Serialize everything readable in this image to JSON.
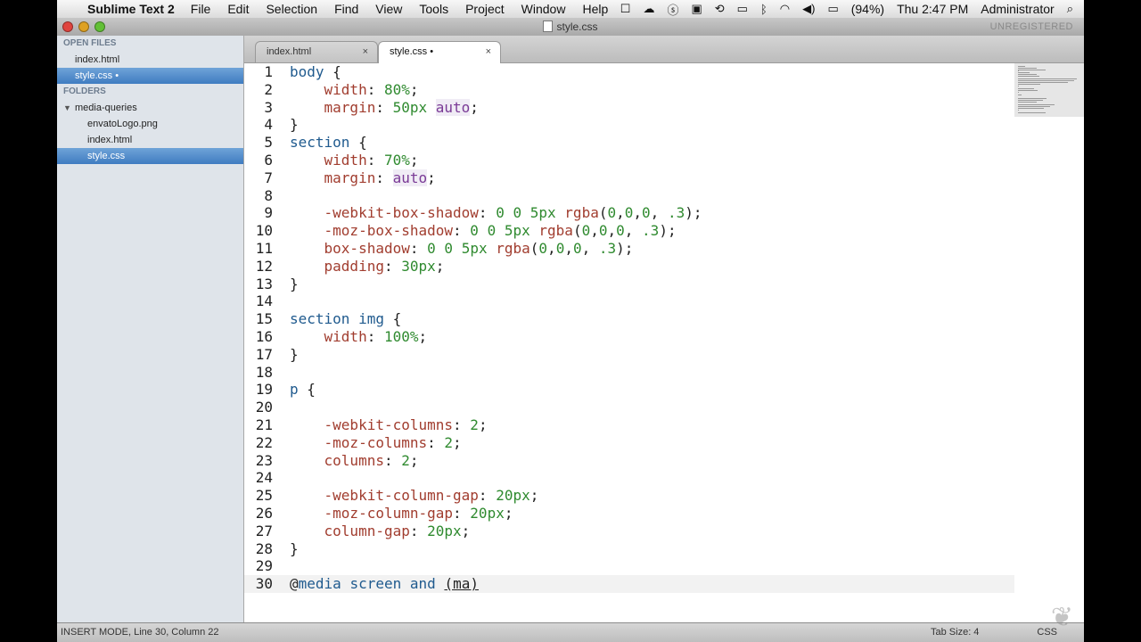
{
  "menubar": {
    "app_name": "Sublime Text 2",
    "menus": [
      "File",
      "Edit",
      "Selection",
      "Find",
      "View",
      "Tools",
      "Project",
      "Window",
      "Help"
    ],
    "battery": "(94%)",
    "clock": "Thu 2:47 PM",
    "user": "Administrator"
  },
  "window": {
    "title": "style.css",
    "unregistered": "UNREGISTERED"
  },
  "sidebar": {
    "open_files_header": "OPEN FILES",
    "open_files": [
      "index.html",
      "style.css"
    ],
    "modified_marker": "•",
    "folders_header": "FOLDERS",
    "folder": "media-queries",
    "folder_files": [
      "envatoLogo.png",
      "index.html",
      "style.css"
    ]
  },
  "tabs": [
    {
      "label": "index.html",
      "close": "×"
    },
    {
      "label": "style.css •",
      "close": "×"
    }
  ],
  "editor": {
    "lines": [
      "body {",
      "    width: 80%;",
      "    margin: 50px auto;",
      "}",
      "section {",
      "    width: 70%;",
      "    margin: auto;",
      "",
      "    -webkit-box-shadow: 0 0 5px rgba(0,0,0, .3);",
      "    -moz-box-shadow: 0 0 5px rgba(0,0,0, .3);",
      "    box-shadow: 0 0 5px rgba(0,0,0, .3);",
      "    padding: 30px;",
      "}",
      "",
      "section img {",
      "    width: 100%;",
      "}",
      "",
      "p {",
      "",
      "    -webkit-columns: 2;",
      "    -moz-columns: 2;",
      "    columns: 2;",
      "",
      "    -webkit-column-gap: 20px;",
      "    -moz-column-gap: 20px;",
      "    column-gap: 20px;",
      "}",
      "",
      "@media screen and (ma)"
    ],
    "current_line": 30
  },
  "statusbar": {
    "mode": "INSERT MODE, Line 30, Column 22",
    "tab_size": "Tab Size: 4",
    "syntax": "CSS"
  }
}
